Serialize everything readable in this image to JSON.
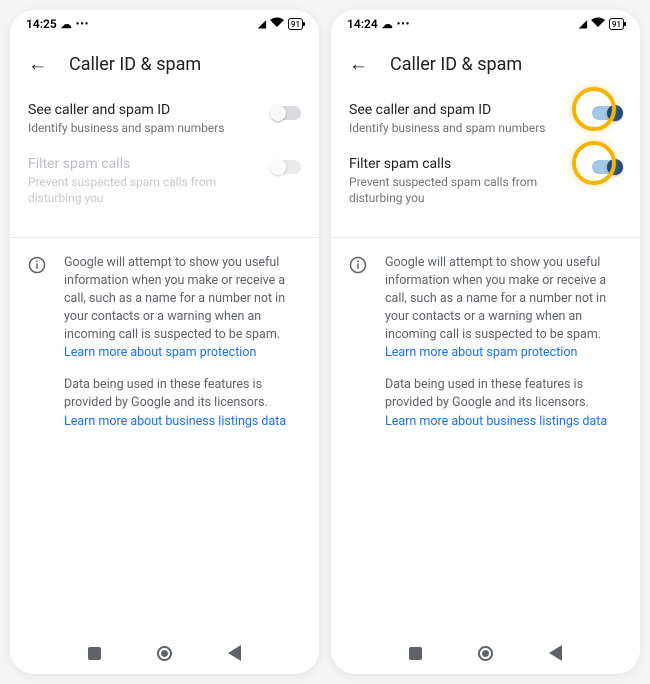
{
  "screens": [
    {
      "status": {
        "time": "14:25",
        "battery": "91"
      },
      "header": {
        "title": "Caller ID & spam"
      },
      "settings": {
        "row1": {
          "title": "See caller and spam ID",
          "sub": "Identify business and spam numbers",
          "on": false,
          "disabled": false,
          "highlight": false
        },
        "row2": {
          "title": "Filter spam calls",
          "sub": "Prevent suspected spam calls from disturbing you",
          "on": false,
          "disabled": true,
          "highlight": false
        }
      },
      "info": {
        "para1": "Google will attempt to show you useful information when you make or receive a call, such as a name for a number not in your contacts or a warning when an incoming call is suspected to be spam. ",
        "link1": "Learn more about spam protection",
        "para2": "Data being used in these features is provided by Google and its licensors. ",
        "link2": "Learn more about business listings data"
      }
    },
    {
      "status": {
        "time": "14:24",
        "battery": "91"
      },
      "header": {
        "title": "Caller ID & spam"
      },
      "settings": {
        "row1": {
          "title": "See caller and spam ID",
          "sub": "Identify business and spam numbers",
          "on": true,
          "disabled": false,
          "highlight": true
        },
        "row2": {
          "title": "Filter spam calls",
          "sub": "Prevent suspected spam calls from disturbing you",
          "on": true,
          "disabled": false,
          "highlight": true
        }
      },
      "info": {
        "para1": "Google will attempt to show you useful information when you make or receive a call, such as a name for a number not in your contacts or a warning when an incoming call is suspected to be spam. ",
        "link1": "Learn more about spam protection",
        "para2": "Data being used in these features is provided by Google and its licensors. ",
        "link2": "Learn more about business listings data"
      }
    }
  ]
}
